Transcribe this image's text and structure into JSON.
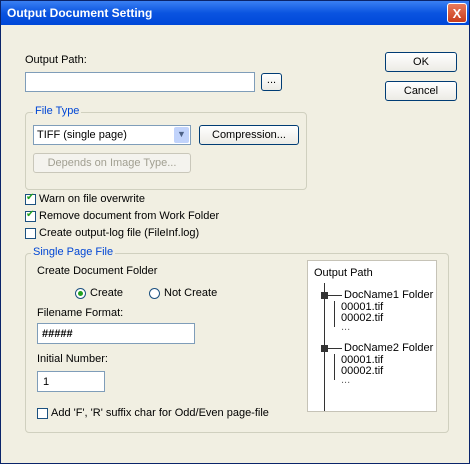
{
  "window": {
    "title": "Output Document Setting",
    "close_glyph": "X"
  },
  "output_path": {
    "label": "Output Path:",
    "value": "",
    "browse_label": "..."
  },
  "buttons": {
    "ok": "OK",
    "cancel": "Cancel"
  },
  "file_type": {
    "group_label": "File Type",
    "selected": "TIFF (single page)",
    "compression_label": "Compression...",
    "depends_label": "Depends on Image Type..."
  },
  "options": {
    "warn_overwrite": {
      "label": "Warn on file overwrite",
      "checked": true
    },
    "remove_document": {
      "label": "Remove document from Work Folder",
      "checked": true
    },
    "create_log": {
      "label": "Create output-log file (FileInf.log)",
      "checked": false
    }
  },
  "single_page": {
    "group_label": "Single Page File",
    "create_folder_label": "Create Document Folder",
    "radio_create": "Create",
    "radio_not_create": "Not Create",
    "filename_format_label": "Filename Format:",
    "filename_format_value": "#####",
    "initial_number_label": "Initial Number:",
    "initial_number_value": "1",
    "suffix_label": "Add 'F', 'R' suffix char for Odd/Even page-file"
  },
  "output_tree": {
    "title": "Output Path",
    "folder1": "DocName1 Folder",
    "folder1_files": [
      "00001.tif",
      "00002.tif",
      "..."
    ],
    "folder2": "DocName2 Folder",
    "folder2_files": [
      "00001.tif",
      "00002.tif",
      "..."
    ]
  },
  "colors": {
    "title_bar": "#0a54e0",
    "dialog_bg": "#f1efe2",
    "group_label": "#0046d5",
    "check_mark": "#21a121"
  }
}
